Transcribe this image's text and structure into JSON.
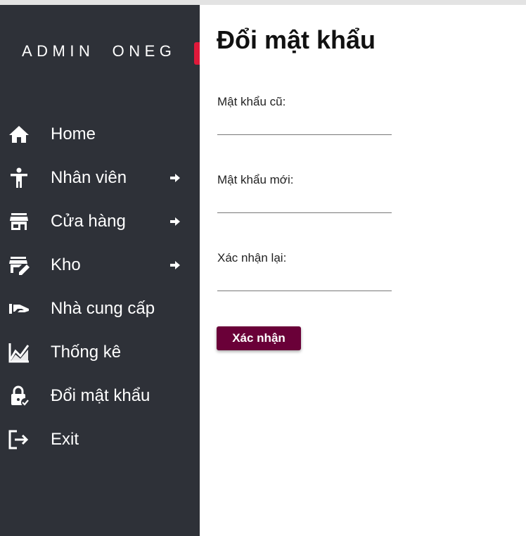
{
  "sidebar": {
    "brand": "ADMIN  ONEG",
    "accent_color": "#e0193a",
    "background": "#2e3138",
    "items": [
      {
        "label": "Home",
        "icon": "home-icon",
        "has_arrow": false
      },
      {
        "label": "Nhân viên",
        "icon": "person-icon",
        "has_arrow": true
      },
      {
        "label": "Cửa hàng",
        "icon": "store-icon",
        "has_arrow": true
      },
      {
        "label": "Kho",
        "icon": "warehouse-edit-icon",
        "has_arrow": true
      },
      {
        "label": "Nhà cung cấp",
        "icon": "supplier-hand-icon",
        "has_arrow": false
      },
      {
        "label": "Thống kê",
        "icon": "chart-icon",
        "has_arrow": false
      },
      {
        "label": "Đổi mật khẩu",
        "icon": "lock-check-icon",
        "has_arrow": false
      },
      {
        "label": "Exit",
        "icon": "exit-icon",
        "has_arrow": false
      }
    ]
  },
  "main": {
    "title": "Đổi mật khẩu",
    "fields": [
      {
        "label": "Mật khẩu cũ:",
        "value": ""
      },
      {
        "label": "Mật khẩu mới:",
        "value": ""
      },
      {
        "label": "Xác nhận lại:",
        "value": ""
      }
    ],
    "submit_label": "Xác nhận",
    "button_color": "#6a0038"
  }
}
